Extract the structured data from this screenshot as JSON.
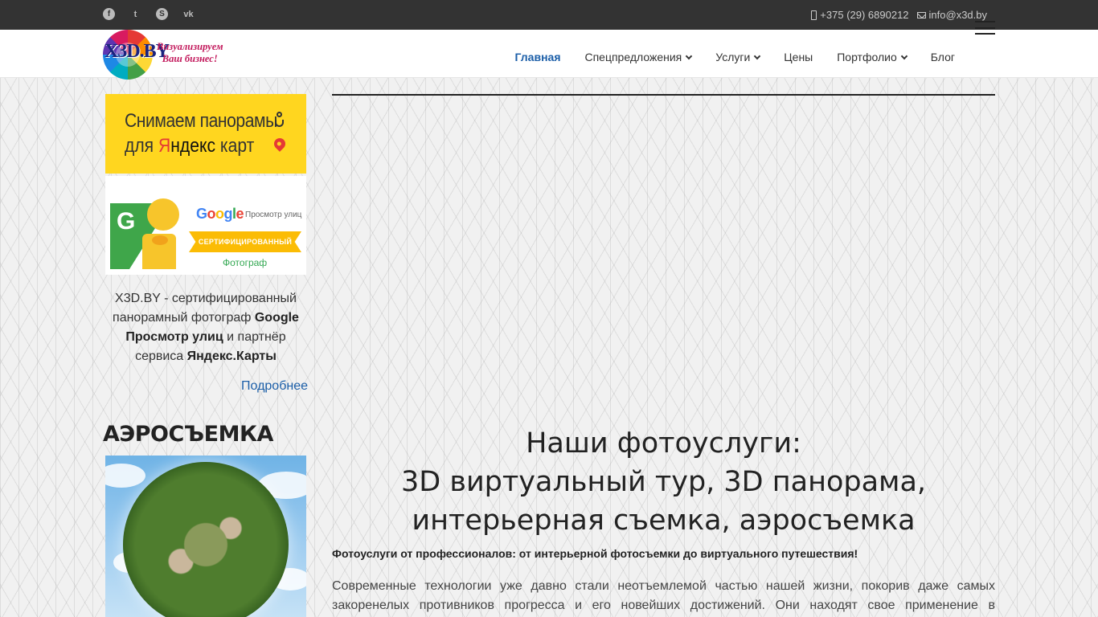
{
  "topbar": {
    "social": [
      {
        "name": "facebook",
        "glyph": "f"
      },
      {
        "name": "twitter",
        "glyph": "t"
      },
      {
        "name": "skype",
        "glyph": "S"
      },
      {
        "name": "vk",
        "glyph": "vk"
      }
    ],
    "phone": "+375 (29) 6890212",
    "email": "info@x3d.by"
  },
  "header": {
    "logo_mark": "X3D.BY",
    "slogan_line1": "Визуализируем",
    "slogan_line2": "Ваш бизнес!",
    "nav": [
      {
        "label": "Главная",
        "active": true,
        "dropdown": false
      },
      {
        "label": "Спецпредложения",
        "active": false,
        "dropdown": true
      },
      {
        "label": "Услуги",
        "active": false,
        "dropdown": true
      },
      {
        "label": "Цены",
        "active": false,
        "dropdown": false
      },
      {
        "label": "Портфолио",
        "active": false,
        "dropdown": true
      },
      {
        "label": "Блог",
        "active": false,
        "dropdown": false
      }
    ]
  },
  "sidebar": {
    "yandex_banner": {
      "line1": "Снимаем панорамы",
      "line2_prefix": "для",
      "brand_first": "Я",
      "brand_rest": "ндекс",
      "line2_suffix": "карт"
    },
    "google_banner": {
      "g_letter": "G",
      "word": [
        "G",
        "o",
        "o",
        "g",
        "l",
        "e"
      ],
      "sub": "Просмотр улиц",
      "ribbon": "СЕРТИФИЦИРОВАННЫЙ",
      "ribbon_sub": "Фотограф"
    },
    "text": {
      "part1": "X3D.BY - сертифицированный панорамный фотограф ",
      "bold1": "Google Просмотр улиц",
      "part2": " и партнёр сервиса ",
      "bold2": "Яндекс.Карты"
    },
    "more_link": "Подробнее",
    "aero_title": "АЭРОСЪЕМКА"
  },
  "main": {
    "heading_line1": "Наши фотоуслуги:",
    "heading_line2": "3D виртуальный тур, 3D панорама,",
    "heading_line3": "интерьерная съемка, аэросъемка",
    "subheading": "Фотоуслуги от профессионалов: от интерьерной фотосъемки до виртуального путешествия!",
    "paragraph": "Современные технологии уже давно стали неотъемлемой частью нашей жизни, покорив даже самых закоренелых противников прогресса и его новейших достижений. Они находят свое применение в"
  },
  "colors": {
    "topbar_bg": "#333333",
    "nav_active": "#1b5ea8",
    "yandex_yellow": "#ffd61f",
    "link": "#1b5ea8"
  }
}
